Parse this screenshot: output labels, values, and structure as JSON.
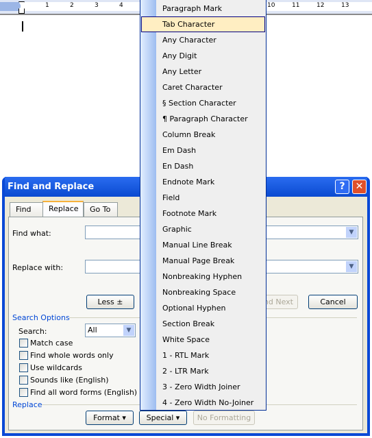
{
  "ruler": {
    "numbers": [
      "1",
      "2",
      "3",
      "4",
      "10",
      "11",
      "12",
      "13"
    ]
  },
  "dialog": {
    "title": "Find and Replace",
    "help_label": "?",
    "close_label": "✕",
    "tabs": [
      {
        "label": "Find"
      },
      {
        "label": "Replace",
        "active": true
      },
      {
        "label": "Go To"
      }
    ],
    "find_what_label": "Find what:",
    "find_what_value": "",
    "replace_with_label": "Replace with:",
    "replace_with_value": "",
    "less_label": "Less ±",
    "find_next_label": "nd Next",
    "cancel_label": "Cancel",
    "search_options_label": "Search Options",
    "search_label": "Search:",
    "search_value": "All",
    "checkboxes": [
      {
        "label": "Match case",
        "checked": false
      },
      {
        "label": "Find whole words only",
        "checked": false
      },
      {
        "label": "Use wildcards",
        "checked": false
      },
      {
        "label": "Sounds like (English)",
        "checked": false
      },
      {
        "label": "Find all word forms (English)",
        "checked": false
      }
    ],
    "replace_group_label": "Replace",
    "format_label": "Format ▾",
    "special_label": "Special ▾",
    "no_formatting_label": "No Formatting"
  },
  "menu": {
    "highlighted": "Tab Character",
    "items": [
      "Paragraph Mark",
      "Tab Character",
      "Any Character",
      "Any Digit",
      "Any Letter",
      "Caret Character",
      "§ Section Character",
      "¶ Paragraph Character",
      "Column Break",
      "Em Dash",
      "En Dash",
      "Endnote Mark",
      "Field",
      "Footnote Mark",
      "Graphic",
      "Manual Line Break",
      "Manual Page Break",
      "Nonbreaking Hyphen",
      "Nonbreaking Space",
      "Optional Hyphen",
      "Section Break",
      "White Space",
      "1 - RTL Mark",
      "2 - LTR Mark",
      "3 - Zero Width Joiner",
      "4 - Zero Width No-Joiner"
    ]
  },
  "colors": {
    "title_bar": "#0a49d6",
    "menu_highlight": "#ffeec2",
    "group_label": "#0046d5"
  }
}
